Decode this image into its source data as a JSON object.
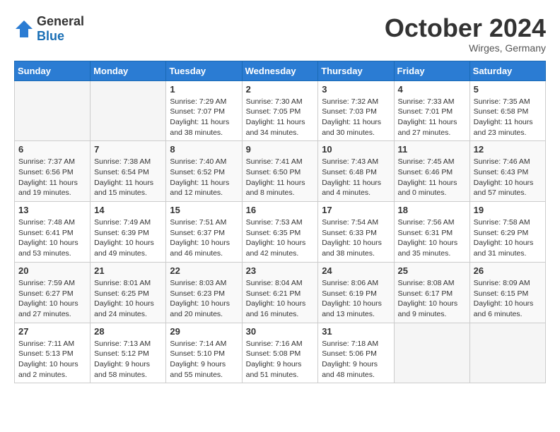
{
  "logo": {
    "general": "General",
    "blue": "Blue"
  },
  "header": {
    "month": "October 2024",
    "location": "Wirges, Germany"
  },
  "weekdays": [
    "Sunday",
    "Monday",
    "Tuesday",
    "Wednesday",
    "Thursday",
    "Friday",
    "Saturday"
  ],
  "weeks": [
    [
      {
        "day": "",
        "empty": true
      },
      {
        "day": "",
        "empty": true
      },
      {
        "day": "1",
        "sunrise": "Sunrise: 7:29 AM",
        "sunset": "Sunset: 7:07 PM",
        "daylight": "Daylight: 11 hours and 38 minutes."
      },
      {
        "day": "2",
        "sunrise": "Sunrise: 7:30 AM",
        "sunset": "Sunset: 7:05 PM",
        "daylight": "Daylight: 11 hours and 34 minutes."
      },
      {
        "day": "3",
        "sunrise": "Sunrise: 7:32 AM",
        "sunset": "Sunset: 7:03 PM",
        "daylight": "Daylight: 11 hours and 30 minutes."
      },
      {
        "day": "4",
        "sunrise": "Sunrise: 7:33 AM",
        "sunset": "Sunset: 7:01 PM",
        "daylight": "Daylight: 11 hours and 27 minutes."
      },
      {
        "day": "5",
        "sunrise": "Sunrise: 7:35 AM",
        "sunset": "Sunset: 6:58 PM",
        "daylight": "Daylight: 11 hours and 23 minutes."
      }
    ],
    [
      {
        "day": "6",
        "sunrise": "Sunrise: 7:37 AM",
        "sunset": "Sunset: 6:56 PM",
        "daylight": "Daylight: 11 hours and 19 minutes."
      },
      {
        "day": "7",
        "sunrise": "Sunrise: 7:38 AM",
        "sunset": "Sunset: 6:54 PM",
        "daylight": "Daylight: 11 hours and 15 minutes."
      },
      {
        "day": "8",
        "sunrise": "Sunrise: 7:40 AM",
        "sunset": "Sunset: 6:52 PM",
        "daylight": "Daylight: 11 hours and 12 minutes."
      },
      {
        "day": "9",
        "sunrise": "Sunrise: 7:41 AM",
        "sunset": "Sunset: 6:50 PM",
        "daylight": "Daylight: 11 hours and 8 minutes."
      },
      {
        "day": "10",
        "sunrise": "Sunrise: 7:43 AM",
        "sunset": "Sunset: 6:48 PM",
        "daylight": "Daylight: 11 hours and 4 minutes."
      },
      {
        "day": "11",
        "sunrise": "Sunrise: 7:45 AM",
        "sunset": "Sunset: 6:46 PM",
        "daylight": "Daylight: 11 hours and 0 minutes."
      },
      {
        "day": "12",
        "sunrise": "Sunrise: 7:46 AM",
        "sunset": "Sunset: 6:43 PM",
        "daylight": "Daylight: 10 hours and 57 minutes."
      }
    ],
    [
      {
        "day": "13",
        "sunrise": "Sunrise: 7:48 AM",
        "sunset": "Sunset: 6:41 PM",
        "daylight": "Daylight: 10 hours and 53 minutes."
      },
      {
        "day": "14",
        "sunrise": "Sunrise: 7:49 AM",
        "sunset": "Sunset: 6:39 PM",
        "daylight": "Daylight: 10 hours and 49 minutes."
      },
      {
        "day": "15",
        "sunrise": "Sunrise: 7:51 AM",
        "sunset": "Sunset: 6:37 PM",
        "daylight": "Daylight: 10 hours and 46 minutes."
      },
      {
        "day": "16",
        "sunrise": "Sunrise: 7:53 AM",
        "sunset": "Sunset: 6:35 PM",
        "daylight": "Daylight: 10 hours and 42 minutes."
      },
      {
        "day": "17",
        "sunrise": "Sunrise: 7:54 AM",
        "sunset": "Sunset: 6:33 PM",
        "daylight": "Daylight: 10 hours and 38 minutes."
      },
      {
        "day": "18",
        "sunrise": "Sunrise: 7:56 AM",
        "sunset": "Sunset: 6:31 PM",
        "daylight": "Daylight: 10 hours and 35 minutes."
      },
      {
        "day": "19",
        "sunrise": "Sunrise: 7:58 AM",
        "sunset": "Sunset: 6:29 PM",
        "daylight": "Daylight: 10 hours and 31 minutes."
      }
    ],
    [
      {
        "day": "20",
        "sunrise": "Sunrise: 7:59 AM",
        "sunset": "Sunset: 6:27 PM",
        "daylight": "Daylight: 10 hours and 27 minutes."
      },
      {
        "day": "21",
        "sunrise": "Sunrise: 8:01 AM",
        "sunset": "Sunset: 6:25 PM",
        "daylight": "Daylight: 10 hours and 24 minutes."
      },
      {
        "day": "22",
        "sunrise": "Sunrise: 8:03 AM",
        "sunset": "Sunset: 6:23 PM",
        "daylight": "Daylight: 10 hours and 20 minutes."
      },
      {
        "day": "23",
        "sunrise": "Sunrise: 8:04 AM",
        "sunset": "Sunset: 6:21 PM",
        "daylight": "Daylight: 10 hours and 16 minutes."
      },
      {
        "day": "24",
        "sunrise": "Sunrise: 8:06 AM",
        "sunset": "Sunset: 6:19 PM",
        "daylight": "Daylight: 10 hours and 13 minutes."
      },
      {
        "day": "25",
        "sunrise": "Sunrise: 8:08 AM",
        "sunset": "Sunset: 6:17 PM",
        "daylight": "Daylight: 10 hours and 9 minutes."
      },
      {
        "day": "26",
        "sunrise": "Sunrise: 8:09 AM",
        "sunset": "Sunset: 6:15 PM",
        "daylight": "Daylight: 10 hours and 6 minutes."
      }
    ],
    [
      {
        "day": "27",
        "sunrise": "Sunrise: 7:11 AM",
        "sunset": "Sunset: 5:13 PM",
        "daylight": "Daylight: 10 hours and 2 minutes."
      },
      {
        "day": "28",
        "sunrise": "Sunrise: 7:13 AM",
        "sunset": "Sunset: 5:12 PM",
        "daylight": "Daylight: 9 hours and 58 minutes."
      },
      {
        "day": "29",
        "sunrise": "Sunrise: 7:14 AM",
        "sunset": "Sunset: 5:10 PM",
        "daylight": "Daylight: 9 hours and 55 minutes."
      },
      {
        "day": "30",
        "sunrise": "Sunrise: 7:16 AM",
        "sunset": "Sunset: 5:08 PM",
        "daylight": "Daylight: 9 hours and 51 minutes."
      },
      {
        "day": "31",
        "sunrise": "Sunrise: 7:18 AM",
        "sunset": "Sunset: 5:06 PM",
        "daylight": "Daylight: 9 hours and 48 minutes."
      },
      {
        "day": "",
        "empty": true
      },
      {
        "day": "",
        "empty": true
      }
    ]
  ]
}
